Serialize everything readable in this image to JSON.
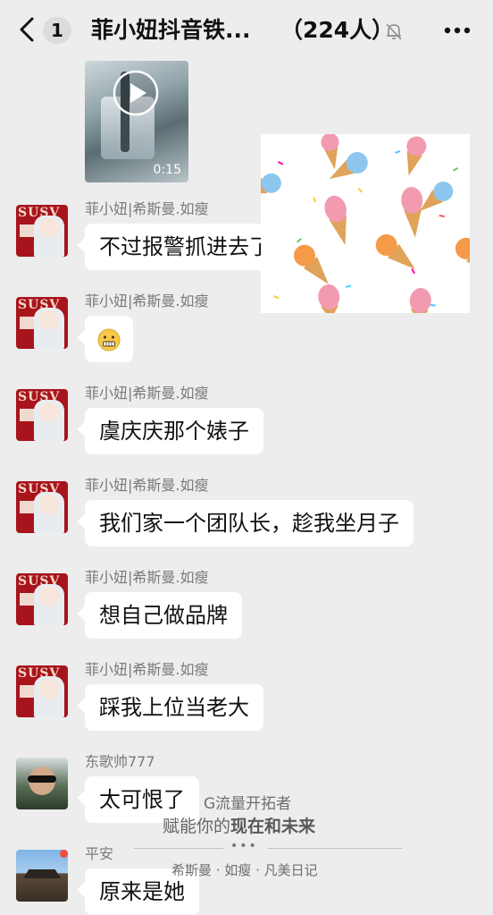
{
  "header": {
    "unread_count": "1",
    "title": "菲小妞抖音铁...",
    "member_count": "（224人）"
  },
  "video": {
    "duration": "0:15"
  },
  "messages": [
    {
      "sender": "菲小妞|希斯曼.如瘦",
      "text": "不过报警抓进去了"
    },
    {
      "sender": "菲小妞|希斯曼.如瘦",
      "text": ""
    },
    {
      "sender": "菲小妞|希斯曼.如瘦",
      "text": "虞庆庆那个婊子"
    },
    {
      "sender": "菲小妞|希斯曼.如瘦",
      "text": "我们家一个团队长，趁我坐月子"
    },
    {
      "sender": "菲小妞|希斯曼.如瘦",
      "text": "想自己做品牌"
    },
    {
      "sender": "菲小妞|希斯曼.如瘦",
      "text": "踩我上位当老大"
    },
    {
      "sender": "东歌帅777",
      "text": "太可恨了"
    },
    {
      "sender": "平安",
      "text": "原来是她"
    }
  ],
  "avatar_brand": "SUSV",
  "watermark": {
    "line1": "G流量开拓者",
    "line2_prefix": "赋能你的",
    "line2_bold": "现在和未来",
    "dots": "•••",
    "line3": "希斯曼 · 如瘦 · 凡美日记"
  },
  "icons": {
    "back": "chevron-left-icon",
    "mute": "bell-off-icon",
    "more": "more-dots-icon",
    "play": "play-icon",
    "emoji": "grimace-emoji-icon"
  }
}
